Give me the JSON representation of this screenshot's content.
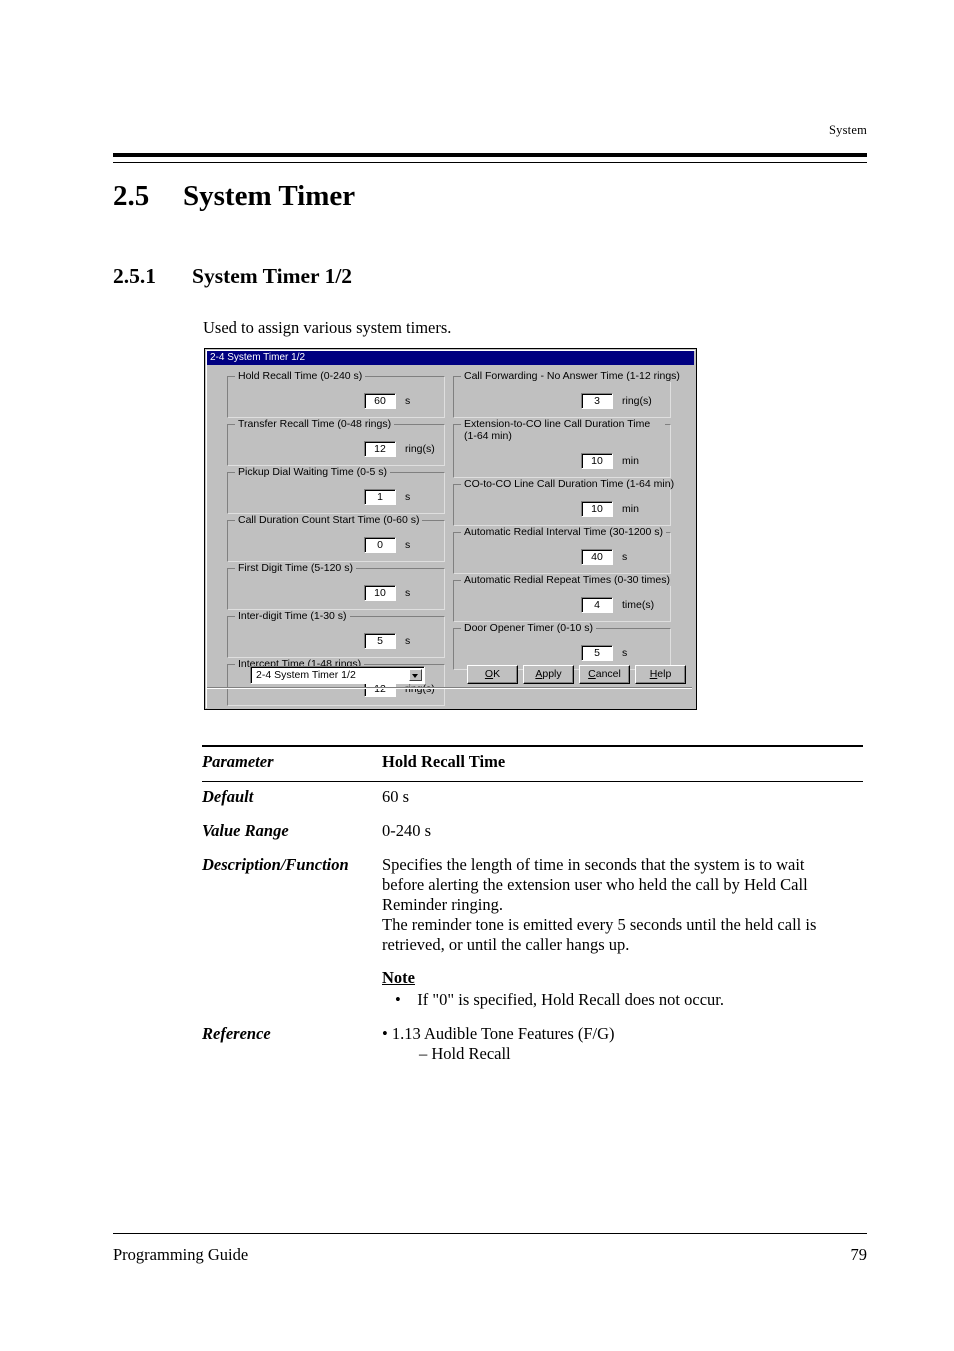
{
  "page": {
    "running_head": "System",
    "footer_left": "Programming Guide",
    "footer_page": "79"
  },
  "headings": {
    "section_number": "2.5",
    "section_title": "System Timer",
    "subsection_number": "2.5.1",
    "subsection_title": "System Timer 1/2",
    "intro": "Used to assign various system timers."
  },
  "dialog": {
    "title": "2-4 System Timer 1/2",
    "left_column": [
      {
        "legend": "Hold Recall Time (0-240 s)",
        "value": "60",
        "unit": "s"
      },
      {
        "legend": "Transfer Recall Time (0-48 rings)",
        "value": "12",
        "unit": "ring(s)"
      },
      {
        "legend": "Pickup Dial Waiting Time (0-5 s)",
        "value": "1",
        "unit": "s"
      },
      {
        "legend": "Call Duration Count Start Time (0-60 s)",
        "value": "0",
        "unit": "s"
      },
      {
        "legend": "First Digit Time (5-120 s)",
        "value": "10",
        "unit": "s"
      },
      {
        "legend": "Inter-digit Time (1-30 s)",
        "value": "5",
        "unit": "s"
      },
      {
        "legend": "Intercept Time (1-48 rings)",
        "value": "12",
        "unit": "ring(s)"
      }
    ],
    "right_column": [
      {
        "legend": "Call Forwarding - No Answer Time (1-12 rings)",
        "value": "3",
        "unit": "ring(s)"
      },
      {
        "legend": "Extension-to-CO line Call Duration Time (1-64 min)",
        "value": "10",
        "unit": "min"
      },
      {
        "legend": "CO-to-CO Line Call Duration Time (1-64 min)",
        "value": "10",
        "unit": "min"
      },
      {
        "legend": "Automatic Redial Interval Time (30-1200 s)",
        "value": "40",
        "unit": "s"
      },
      {
        "legend": "Automatic Redial Repeat Times (0-30 times)",
        "value": "4",
        "unit": "time(s)"
      },
      {
        "legend": "Door Opener Timer (0-10 s)",
        "value": "5",
        "unit": "s"
      }
    ],
    "combo_value": "2-4 System Timer 1/2",
    "buttons": {
      "ok": "OK",
      "apply": "Apply",
      "cancel": "Cancel",
      "help": "Help"
    }
  },
  "parameter_table": {
    "row_parameter_label": "Parameter",
    "row_parameter_value": "Hold Recall Time",
    "row_default_label": "Default",
    "row_default_value": "60 s",
    "row_range_label": "Value Range",
    "row_range_value": "0-240 s",
    "row_description_label": "Description/Function",
    "description_line1": "Specifies the length of time in seconds that the system is to wait",
    "description_line2": "before alerting the extension user who held the call by Held Call",
    "description_line3": "Reminder ringing.",
    "description_line4": "The reminder tone is emitted every 5 seconds until the held call is",
    "description_line5": "retrieved, or until the caller hangs up.",
    "note_heading": "Note",
    "note_bullet": "• If \"0\" is specified, Hold Recall does not occur.",
    "row_reference_label": "Reference",
    "reference_line1": "• 1.13 Audible Tone Features (F/G)",
    "reference_line2": "– Hold Recall"
  },
  "colors": {
    "titlebar": "#000080",
    "dialog_face": "#c0c0c0",
    "shadow": "#808080"
  }
}
